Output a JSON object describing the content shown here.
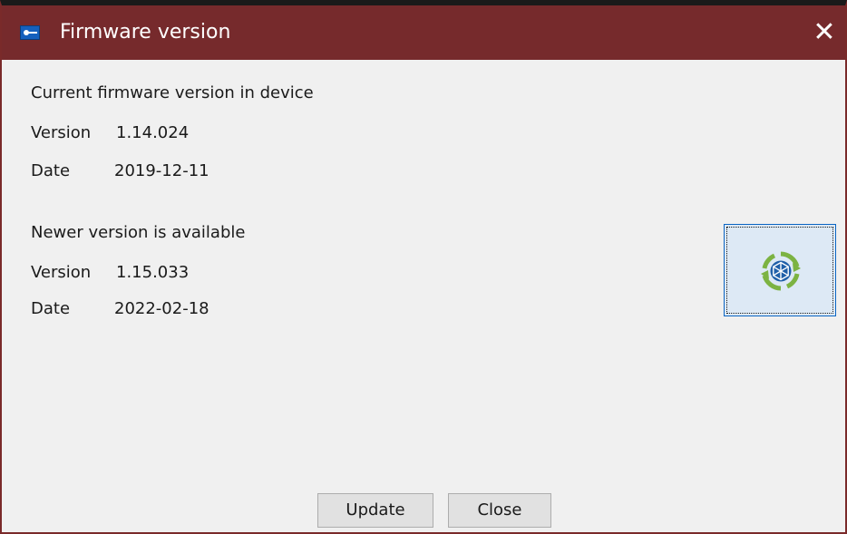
{
  "window": {
    "title": "Firmware version"
  },
  "current": {
    "heading": "Current firmware version in device",
    "version_label": "Version",
    "version_value": "1.14.024",
    "date_label": "Date",
    "date_value": "2019-12-11"
  },
  "newer": {
    "heading": "Newer version is available",
    "version_label": "Version",
    "version_value": "1.15.033",
    "date_label": "Date",
    "date_value": "2022-02-18"
  },
  "buttons": {
    "update_label": "Update",
    "close_label": "Close"
  },
  "icons": {
    "app": "app-key-icon",
    "close": "close-icon",
    "update": "firmware-update-icon"
  },
  "colors": {
    "titlebar": "#762a2c",
    "accent_green": "#7cb342",
    "accent_blue": "#1f5fa8"
  }
}
